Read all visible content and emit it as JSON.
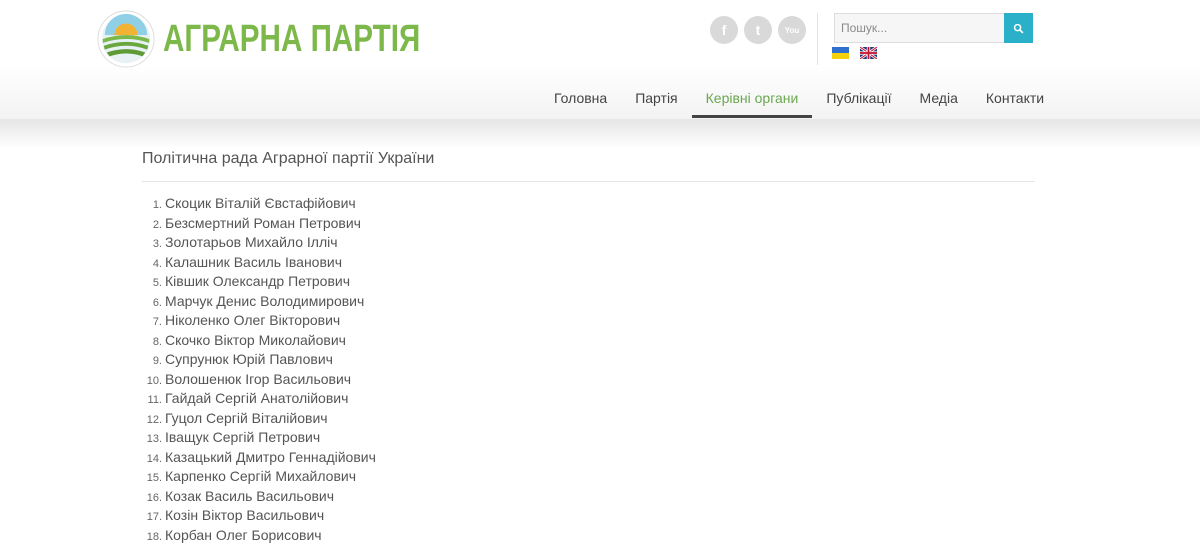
{
  "header": {
    "logo_text": "АГРАРНА ПАРТІЯ",
    "social": [
      {
        "id": "facebook",
        "glyph": "f"
      },
      {
        "id": "twitter",
        "glyph": "t"
      },
      {
        "id": "youtube",
        "glyph": "You"
      }
    ],
    "search": {
      "placeholder": "Пошук..."
    },
    "languages": [
      "uk",
      "en"
    ],
    "nav": [
      {
        "label": "Головна"
      },
      {
        "label": "Партія"
      },
      {
        "label": "Керівні органи",
        "active": true
      },
      {
        "label": "Публікації"
      },
      {
        "label": "Медіа"
      },
      {
        "label": "Контакти"
      }
    ]
  },
  "colors": {
    "brand_green": "#7cb84a",
    "nav_active": "#6aa84f",
    "search_button": "#2ab0c8"
  },
  "content": {
    "title": "Політична рада Аграрної партії України",
    "members": [
      {
        "num": "1.",
        "name": "Скоцик Віталій Євстафійович"
      },
      {
        "num": "2.",
        "name": "Безсмертний Роман Петрович"
      },
      {
        "num": "3.",
        "name": "Золотарьов Михайло Ілліч"
      },
      {
        "num": "4.",
        "name": "Калашник Василь Іванович"
      },
      {
        "num": "5.",
        "name": "Ківшик Олександр Петрович"
      },
      {
        "num": "6.",
        "name": "Марчук Денис Володимирович"
      },
      {
        "num": "7.",
        "name": "Ніколенко Олег Вікторович"
      },
      {
        "num": "8.",
        "name": "Скочко Віктор Миколайович"
      },
      {
        "num": "9.",
        "name": "Супрунюк Юрій Павлович"
      },
      {
        "num": "10.",
        "name": "Волошенюк Ігор Васильович"
      },
      {
        "num": "11.",
        "name": "Гайдай Сергій Анатолійович"
      },
      {
        "num": "12.",
        "name": "Гуцол Сергій Віталійович"
      },
      {
        "num": "13.",
        "name": "Іващук Сергій Петрович"
      },
      {
        "num": "14.",
        "name": "Казацький Дмитро Геннадійович"
      },
      {
        "num": "15.",
        "name": "Карпенко Сергій  Михайлович"
      },
      {
        "num": "16.",
        "name": "Козак Василь Васильович"
      },
      {
        "num": "17.",
        "name": "Козін Віктор Васильович"
      },
      {
        "num": "18.",
        "name": "Корбан Олег Борисович"
      }
    ]
  }
}
